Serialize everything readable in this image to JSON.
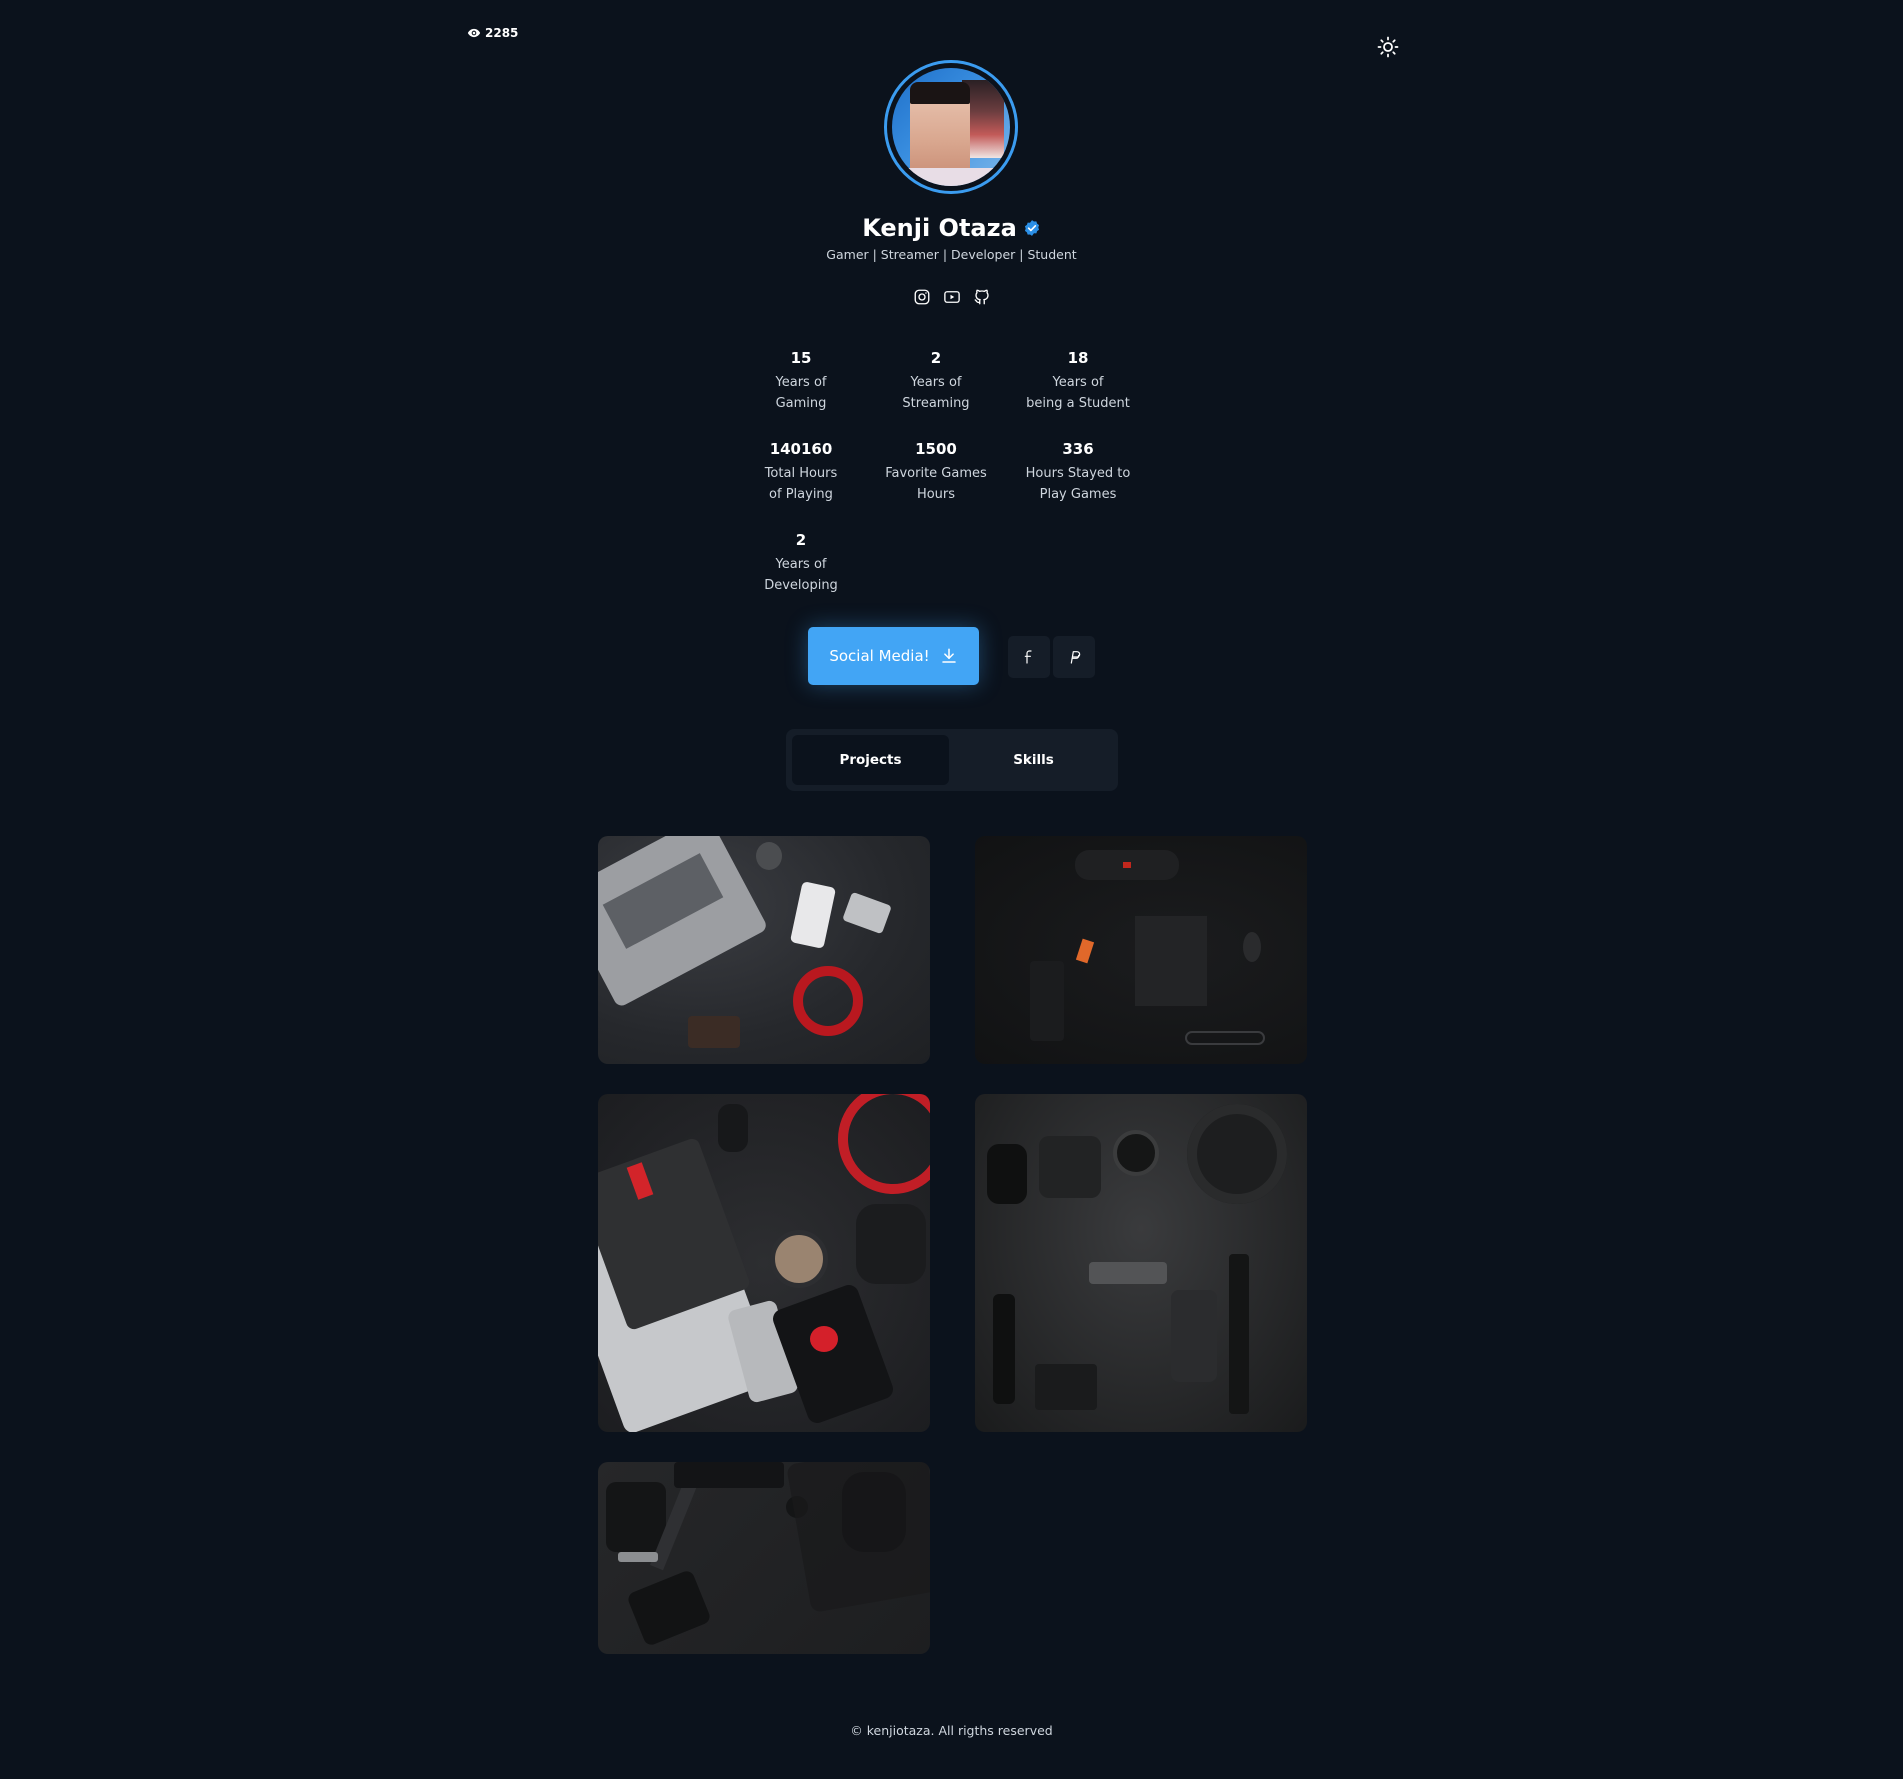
{
  "header": {
    "views_count": "2285",
    "views_icon": "eye-icon",
    "theme_icon": "sun-icon"
  },
  "profile": {
    "name": "Kenji Otaza",
    "verified_icon": "verified-badge-icon",
    "tagline": "Gamer | Streamer | Developer | Student",
    "accent_color": "#42a5f5"
  },
  "socials": [
    {
      "icon": "instagram-icon"
    },
    {
      "icon": "youtube-icon"
    },
    {
      "icon": "github-icon"
    }
  ],
  "stats": [
    {
      "value": "15",
      "label": "Years of\nGaming"
    },
    {
      "value": "2",
      "label": "Years of\nStreaming"
    },
    {
      "value": "18",
      "label": "Years of\nbeing a Student"
    },
    {
      "value": "140160",
      "label": "Total Hours\nof Playing"
    },
    {
      "value": "1500",
      "label": "Favorite Games\nHours"
    },
    {
      "value": "336",
      "label": "Hours Stayed to\nPlay Games"
    },
    {
      "value": "2",
      "label": "Years of\nDeveloping"
    }
  ],
  "actions": {
    "cta_label": "Social Media!",
    "cta_icon": "download-icon",
    "facebook_icon": "facebook-icon",
    "paypal_icon": "paypal-icon"
  },
  "tabs": [
    {
      "label": "Projects",
      "active": true
    },
    {
      "label": "Skills",
      "active": false
    }
  ],
  "footer": {
    "text": "© kenjiotaza. All rigths reserved"
  }
}
